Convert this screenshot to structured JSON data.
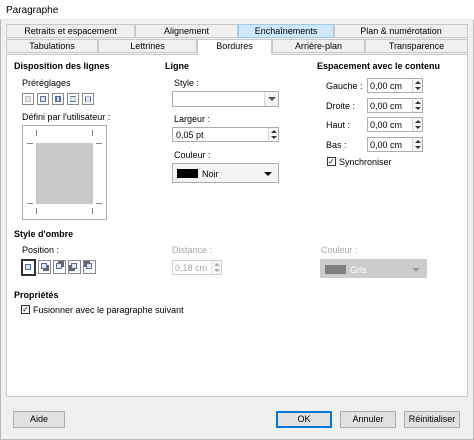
{
  "window": {
    "title": "Paragraphe"
  },
  "tabs_row1": [
    "Retraits et espacement",
    "Alignement",
    "Enchaînements",
    "Plan & numérotation"
  ],
  "tabs_row2": [
    "Tabulations",
    "Lettrines",
    "Bordures",
    "Arrière-plan",
    "Transparence"
  ],
  "line_arrangement": {
    "heading": "Disposition des lignes",
    "presets_label": "Préréglages",
    "user_defined_label": "Défini par l'utilisateur :"
  },
  "line": {
    "heading": "Ligne",
    "style_label": "Style :",
    "style_value": "",
    "width_label": "Largeur :",
    "width_value": "0,05 pt",
    "color_label": "Couleur :",
    "color_value": "Noir",
    "color_swatch": "#000000"
  },
  "padding": {
    "heading": "Espacement avec le contenu",
    "left_label": "Gauche :",
    "left_value": "0,00 cm",
    "right_label": "Droite :",
    "right_value": "0,00 cm",
    "top_label": "Haut :",
    "top_value": "0,00 cm",
    "bottom_label": "Bas :",
    "bottom_value": "0,00 cm",
    "sync_label": "Synchroniser",
    "sync_checked": true
  },
  "shadow": {
    "heading": "Style d'ombre",
    "position_label": "Position :",
    "distance_label": "Distance :",
    "distance_value": "0,18 cm",
    "color_label": "Couleur :",
    "color_value": "Gris",
    "color_swatch": "#808080"
  },
  "properties": {
    "heading": "Propriétés",
    "merge_label": "Fusionner avec le paragraphe suivant",
    "merge_checked": true
  },
  "buttons": {
    "help": "Aide",
    "ok": "OK",
    "cancel": "Annuler",
    "reset": "Réinitialiser"
  }
}
